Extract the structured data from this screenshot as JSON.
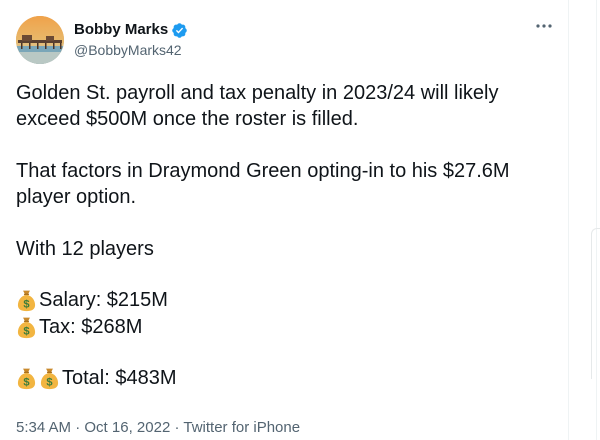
{
  "author": {
    "display_name": "Bobby Marks",
    "handle": "@BobbyMarks42",
    "verified": true,
    "avatar": "beach-pier-photo"
  },
  "menu": {
    "more_icon": "more-horizontal-icon"
  },
  "tweet": {
    "paragraph1": "Golden St. payroll and tax penalty in 2023/24 will likely exceed $500M once the roster is filled.",
    "paragraph2": "That factors in Draymond Green opting-in to his $27.6M player option.",
    "paragraph3": "With 12 players",
    "salary_line": "Salary: $215M",
    "tax_line": "Tax: $268M",
    "total_line": "Total: $483M",
    "emoji_icon": "money-bag-icon"
  },
  "meta": {
    "time": "5:34 AM",
    "separator": " · ",
    "date": "Oct 16, 2022",
    "source": "Twitter for iPhone"
  },
  "colors": {
    "text": "#0f1419",
    "secondary": "#536471",
    "verified": "#1d9bf0",
    "divider": "#eff3f4"
  }
}
